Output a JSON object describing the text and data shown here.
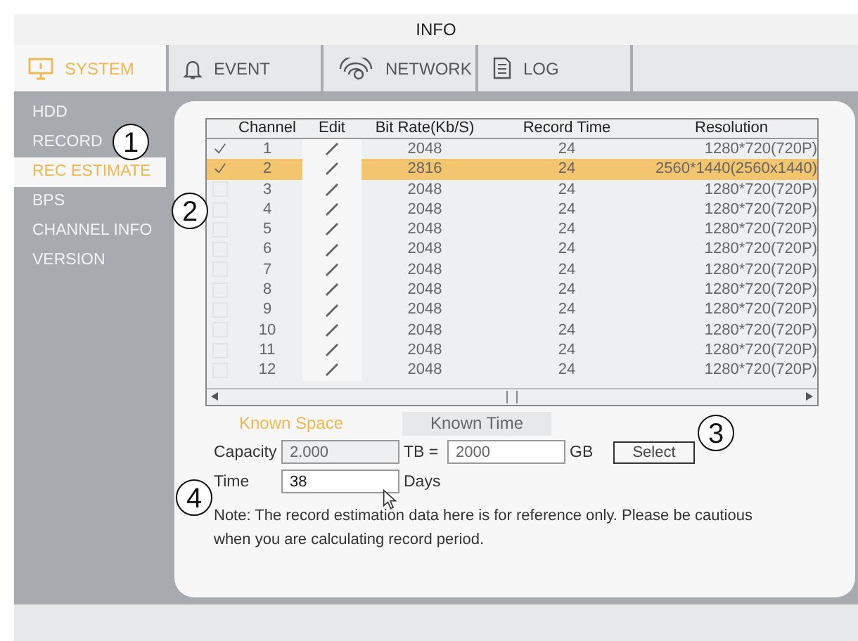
{
  "window": {
    "title": "INFO"
  },
  "tabs": [
    {
      "label": "SYSTEM",
      "selected": true
    },
    {
      "label": "EVENT",
      "selected": false
    },
    {
      "label": "NETWORK",
      "selected": false
    },
    {
      "label": "LOG",
      "selected": false
    }
  ],
  "sidebar": {
    "items": [
      {
        "label": "HDD",
        "selected": false
      },
      {
        "label": "RECORD",
        "selected": false
      },
      {
        "label": "REC ESTIMATE",
        "selected": true
      },
      {
        "label": "BPS",
        "selected": false
      },
      {
        "label": "CHANNEL INFO",
        "selected": false
      },
      {
        "label": "VERSION",
        "selected": false
      }
    ]
  },
  "table": {
    "columns": [
      "Channel",
      "Edit",
      "Bit Rate(Kb/S)",
      "Record Time",
      "Resolution"
    ],
    "rows": [
      {
        "checked": true,
        "selected": false,
        "channel": "1",
        "bit_rate": "2048",
        "record_time": "24",
        "resolution": "1280*720(720P)"
      },
      {
        "checked": true,
        "selected": true,
        "channel": "2",
        "bit_rate": "2816",
        "record_time": "24",
        "resolution": "2560*1440(2560x1440)"
      },
      {
        "checked": false,
        "selected": false,
        "channel": "3",
        "bit_rate": "2048",
        "record_time": "24",
        "resolution": "1280*720(720P)"
      },
      {
        "checked": false,
        "selected": false,
        "channel": "4",
        "bit_rate": "2048",
        "record_time": "24",
        "resolution": "1280*720(720P)"
      },
      {
        "checked": false,
        "selected": false,
        "channel": "5",
        "bit_rate": "2048",
        "record_time": "24",
        "resolution": "1280*720(720P)"
      },
      {
        "checked": false,
        "selected": false,
        "channel": "6",
        "bit_rate": "2048",
        "record_time": "24",
        "resolution": "1280*720(720P)"
      },
      {
        "checked": false,
        "selected": false,
        "channel": "7",
        "bit_rate": "2048",
        "record_time": "24",
        "resolution": "1280*720(720P)"
      },
      {
        "checked": false,
        "selected": false,
        "channel": "8",
        "bit_rate": "2048",
        "record_time": "24",
        "resolution": "1280*720(720P)"
      },
      {
        "checked": false,
        "selected": false,
        "channel": "9",
        "bit_rate": "2048",
        "record_time": "24",
        "resolution": "1280*720(720P)"
      },
      {
        "checked": false,
        "selected": false,
        "channel": "10",
        "bit_rate": "2048",
        "record_time": "24",
        "resolution": "1280*720(720P)"
      },
      {
        "checked": false,
        "selected": false,
        "channel": "11",
        "bit_rate": "2048",
        "record_time": "24",
        "resolution": "1280*720(720P)"
      },
      {
        "checked": false,
        "selected": false,
        "channel": "12",
        "bit_rate": "2048",
        "record_time": "24",
        "resolution": "1280*720(720P)"
      }
    ]
  },
  "mode_tabs": [
    {
      "label": "Known Space",
      "selected": true
    },
    {
      "label": "Known Time",
      "selected": false
    }
  ],
  "capacity": {
    "label": "Capacity",
    "tb_value": "2.000",
    "tb_unit": "TB =",
    "gb_value": "2000",
    "gb_unit": "GB",
    "button": "Select"
  },
  "time": {
    "label": "Time",
    "value": "38",
    "unit": "Days"
  },
  "note": "Note: The record estimation data here is for reference only. Please be cautious when you are calculating record period.",
  "callouts": [
    "1",
    "2",
    "3",
    "4"
  ]
}
